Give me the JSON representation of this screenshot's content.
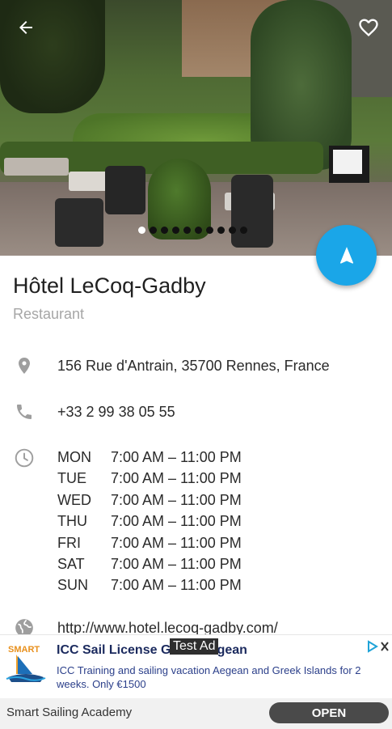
{
  "place": {
    "name": "Hôtel LeCoq-Gadby",
    "category": "Restaurant",
    "address": "156 Rue d'Antrain, 35700 Rennes, France",
    "phone": "+33 2 99 38 05 55",
    "website": "http://www.hotel.lecoq-gadby.com/",
    "hours": [
      {
        "day": "MON",
        "time": "7:00 AM – 11:00 PM"
      },
      {
        "day": "TUE",
        "time": "7:00 AM – 11:00 PM"
      },
      {
        "day": "WED",
        "time": "7:00 AM – 11:00 PM"
      },
      {
        "day": "THU",
        "time": "7:00 AM – 11:00 PM"
      },
      {
        "day": "FRI",
        "time": "7:00 AM – 11:00 PM"
      },
      {
        "day": "SAT",
        "time": "7:00 AM – 11:00 PM"
      },
      {
        "day": "SUN",
        "time": "7:00 AM – 11:00 PM"
      }
    ]
  },
  "gallery": {
    "page_count": 10,
    "active_index": 0
  },
  "icons": {
    "back": "arrow-left-icon",
    "favorite": "heart-outline-icon",
    "navigate": "navigation-arrow-icon",
    "address": "location-pin-icon",
    "phone": "phone-icon",
    "hours": "clock-icon",
    "website": "globe-icon"
  },
  "colors": {
    "accent": "#1aa6e8",
    "title_text": "#202020",
    "subtitle_text": "#a6a6a6",
    "icon_gray": "#9e9e9e"
  },
  "ad": {
    "label": "Test Ad",
    "title": "ICC Sail License Greek Aegean",
    "description": "ICC Training and sailing vacation Aegean and Greek Islands for 2 weeks. Only €1500",
    "advertiser": "Smart Sailing Academy",
    "cta": "OPEN"
  }
}
